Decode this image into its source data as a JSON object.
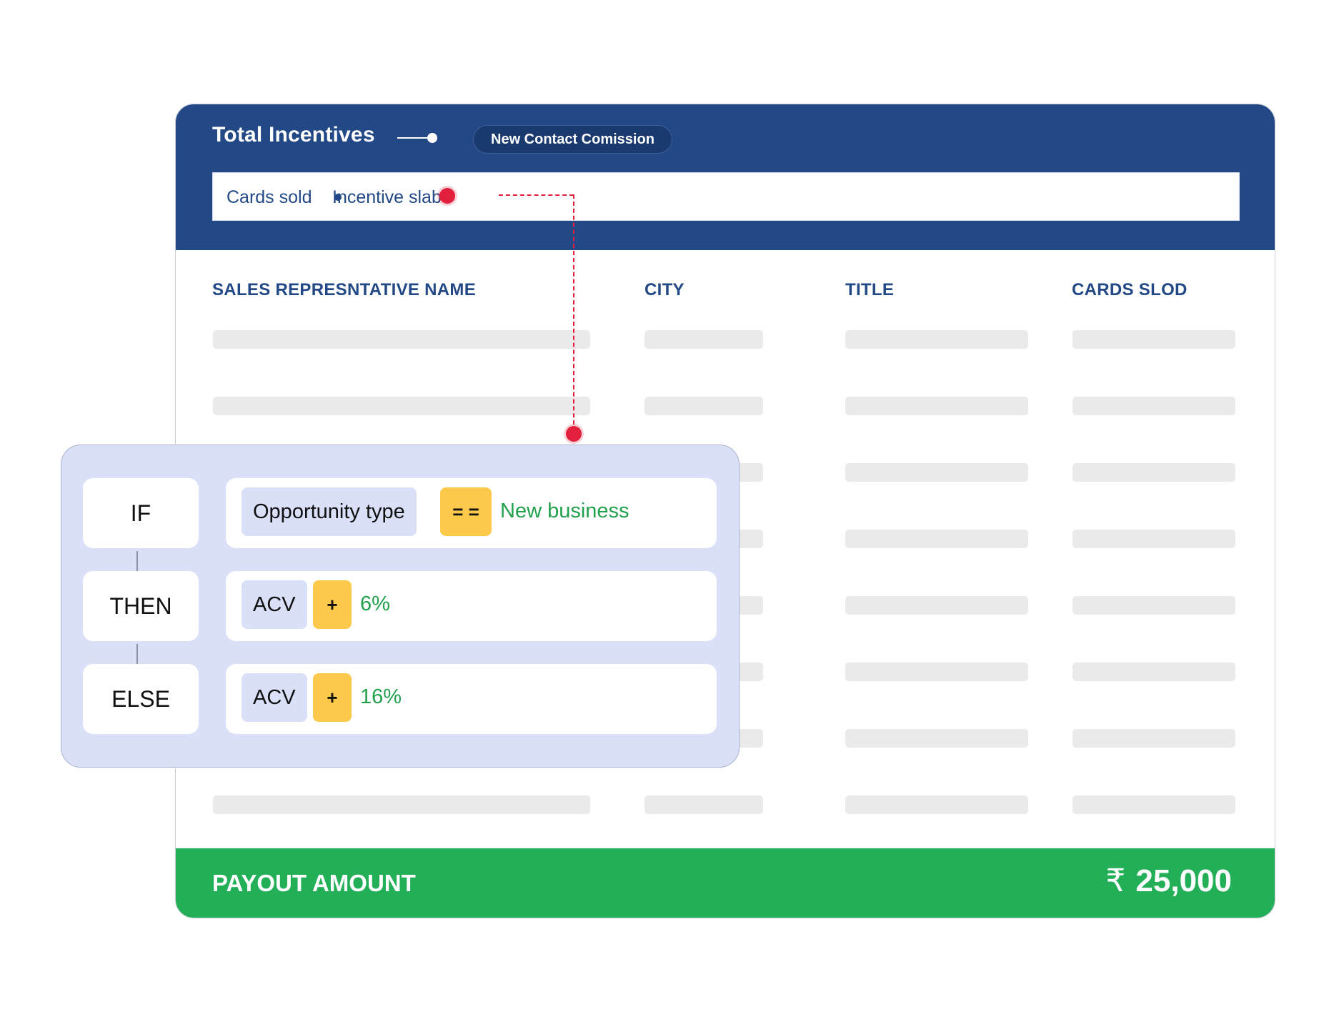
{
  "header": {
    "title": "Total Incentives",
    "tag": "New Contact Comission",
    "filters": [
      "Cards sold",
      "Incentive slab"
    ]
  },
  "table": {
    "columns": [
      "SALES REPRESNTATIVE NAME",
      "CITY",
      "TITLE",
      "CARDS SLOD"
    ]
  },
  "rule": {
    "if": {
      "keyword": "IF",
      "field": "Opportunity type",
      "operator": "= =",
      "value": "New business"
    },
    "then": {
      "keyword": "THEN",
      "field": "ACV",
      "operator": "+",
      "value": "6%"
    },
    "else": {
      "keyword": "ELSE",
      "field": "ACV",
      "operator": "+",
      "value": "16%"
    }
  },
  "footer": {
    "label": "PAYOUT AMOUNT",
    "currency": "₹",
    "amount": "25,000"
  },
  "colors": {
    "header_blue": "#224886",
    "payout_green": "#22af58",
    "accent_red": "#e21f3c",
    "operator_yellow": "#fcc94a",
    "panel_lavender": "#d9e0f7",
    "value_green": "#22a04d"
  }
}
